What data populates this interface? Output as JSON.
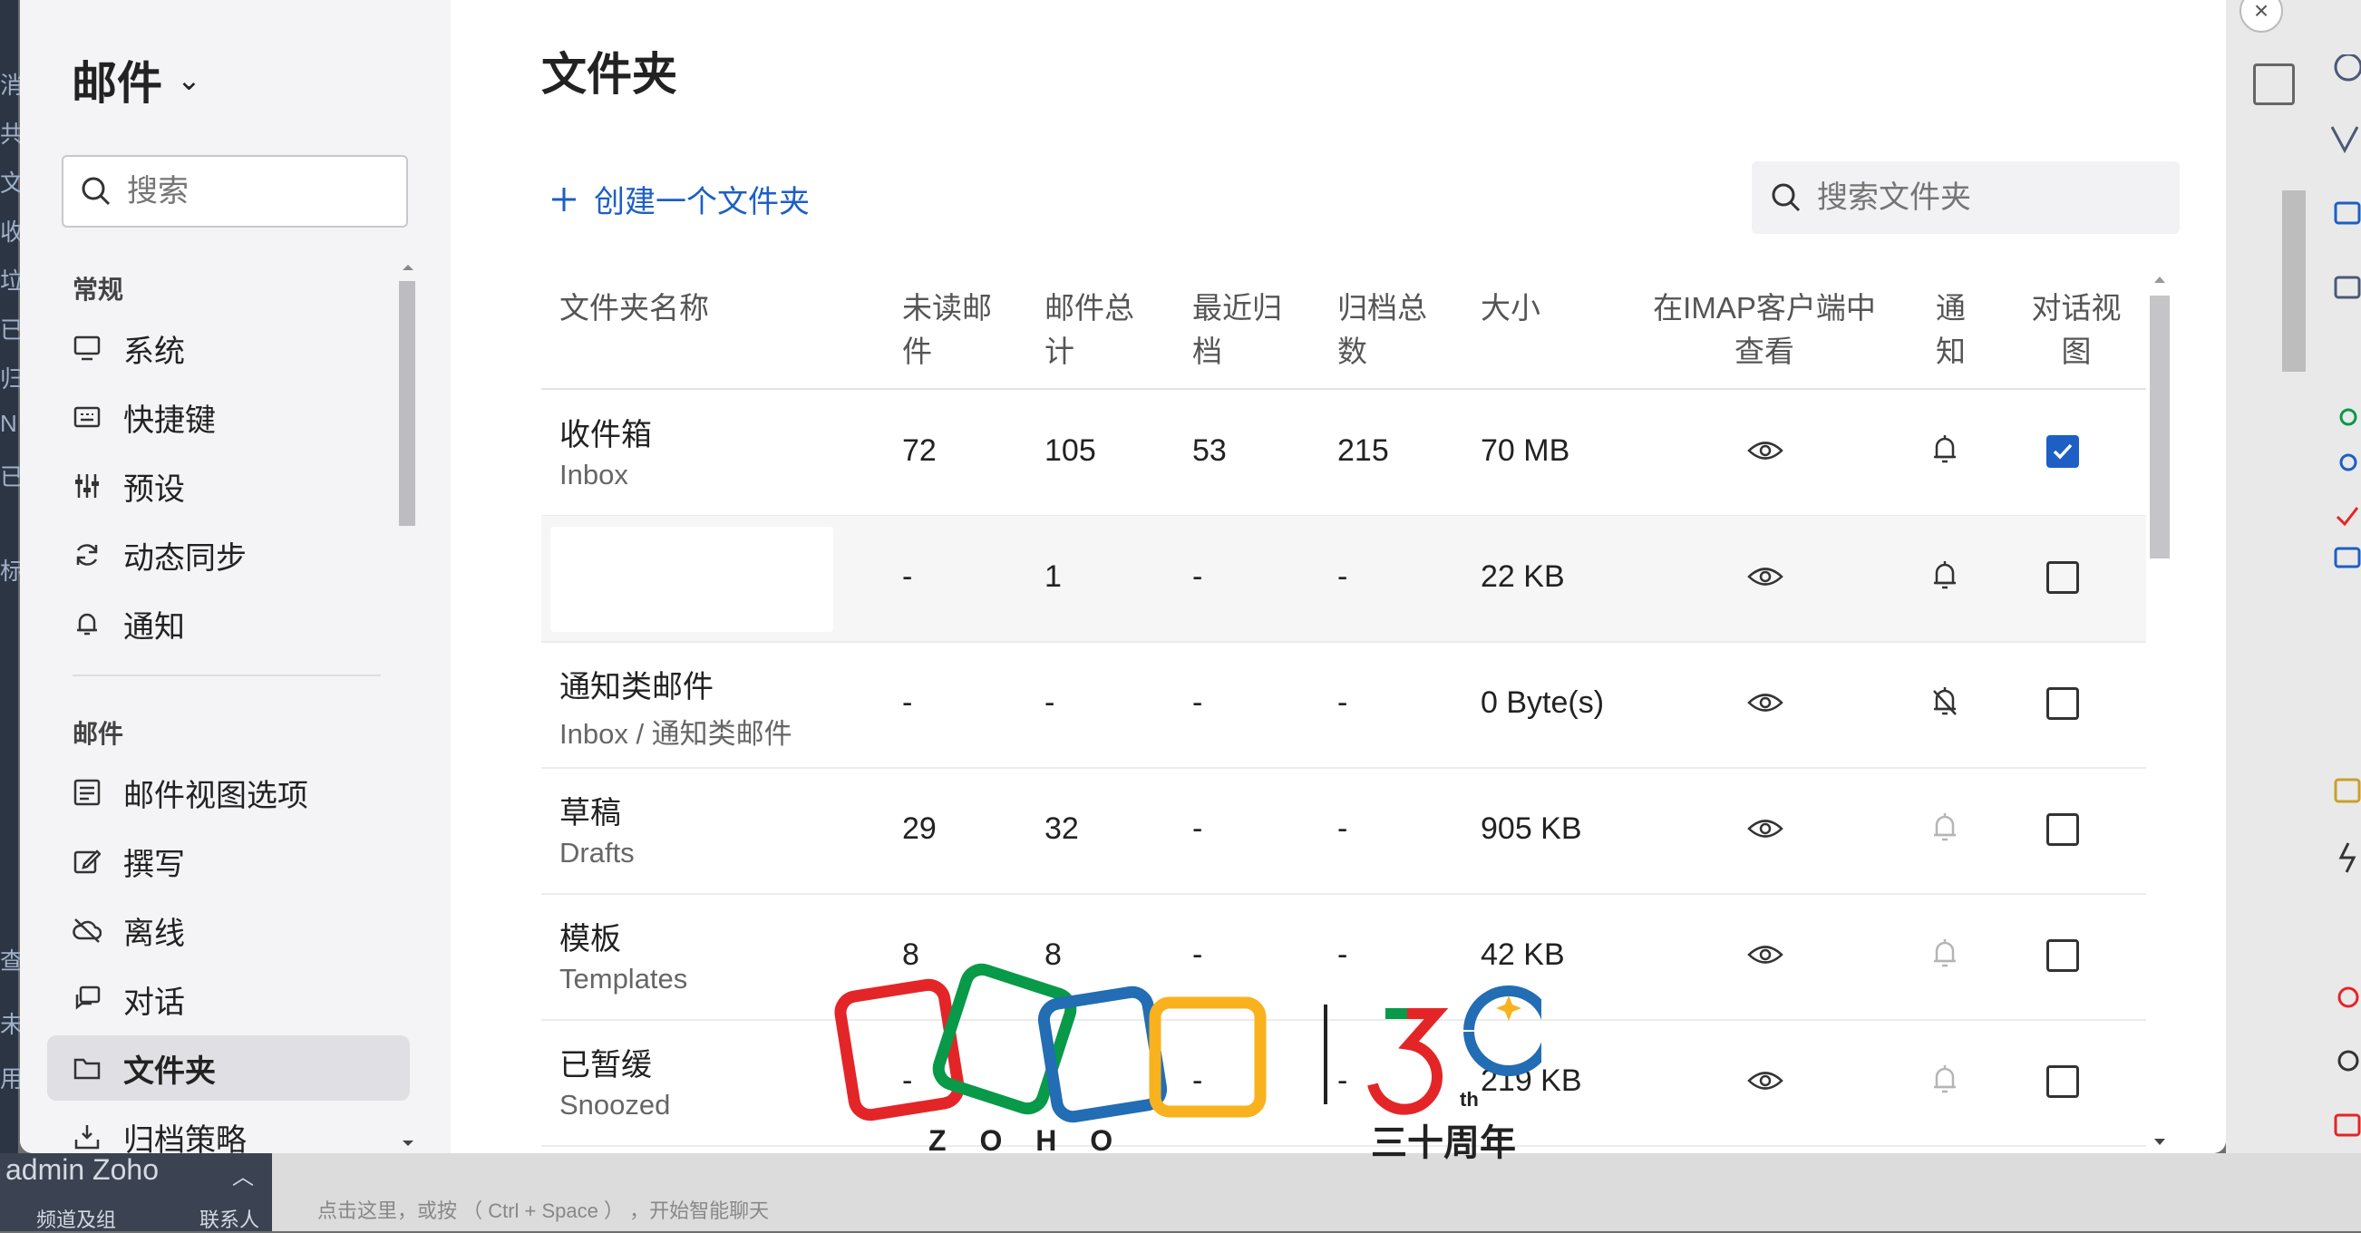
{
  "background": {
    "left_fragments": [
      "消",
      "共",
      "文",
      "收",
      "垃",
      "已",
      "归",
      "N",
      "已",
      "标",
      "查",
      "未",
      "用"
    ],
    "user": "admin Zoho",
    "bottom_tip": "点击这里，或按 （ Ctrl + Space ） ，开始智能聊天",
    "bottom_channels": "频道及组",
    "bottom_contacts": "联系人"
  },
  "sidebar": {
    "title": "邮件",
    "search_placeholder": "搜索",
    "sections": [
      {
        "label": "常规",
        "items": [
          {
            "label": "系统",
            "icon": "monitor-icon"
          },
          {
            "label": "快捷键",
            "icon": "keyboard-icon"
          },
          {
            "label": "预设",
            "icon": "sliders-icon"
          },
          {
            "label": "动态同步",
            "icon": "sync-icon"
          },
          {
            "label": "通知",
            "icon": "bell-icon"
          }
        ]
      },
      {
        "label": "邮件",
        "items": [
          {
            "label": "邮件视图选项",
            "icon": "layout-icon"
          },
          {
            "label": "撰写",
            "icon": "edit-icon"
          },
          {
            "label": "离线",
            "icon": "cloud-off-icon"
          },
          {
            "label": "对话",
            "icon": "chat-icon"
          },
          {
            "label": "文件夹",
            "icon": "folder-icon"
          },
          {
            "label": "归档策略",
            "icon": "archive-icon"
          }
        ]
      }
    ]
  },
  "main": {
    "title": "文件夹",
    "create_label": "创建一个文件夹",
    "search_placeholder": "搜索文件夹",
    "columns": {
      "name": "文件夹名称",
      "unread_1": "未读邮",
      "unread_2": "件",
      "total_1": "邮件总",
      "total_2": "计",
      "recent_1": "最近归",
      "recent_2": "档",
      "archived_1": "归档总",
      "archived_2": "数",
      "size": "大小",
      "imap_1": "在IMAP客户端中",
      "imap_2": "查看",
      "notify_1": "通",
      "notify_2": "知",
      "conv_1": "对话视",
      "conv_2": "图"
    },
    "rows": [
      {
        "name": "收件箱",
        "path": "Inbox",
        "unread": "72",
        "total": "105",
        "recent": "53",
        "archived": "215",
        "size": "70 MB",
        "notify": "on",
        "conversation": true
      },
      {
        "name": "",
        "path": "",
        "unread": "-",
        "total": "1",
        "recent": "-",
        "archived": "-",
        "size": "22 KB",
        "notify": "on",
        "conversation": false
      },
      {
        "name": "通知类邮件",
        "path": "Inbox / 通知类邮件",
        "unread": "-",
        "total": "-",
        "recent": "-",
        "archived": "-",
        "size": "0 Byte(s)",
        "notify": "off",
        "conversation": false
      },
      {
        "name": "草稿",
        "path": "Drafts",
        "unread": "29",
        "total": "32",
        "recent": "-",
        "archived": "-",
        "size": "905 KB",
        "notify": "disabled",
        "conversation": false
      },
      {
        "name": "模板",
        "path": "Templates",
        "unread": "8",
        "total": "8",
        "recent": "-",
        "archived": "-",
        "size": "42 KB",
        "notify": "disabled",
        "conversation": false
      },
      {
        "name": "已暂缓",
        "path": "Snoozed",
        "unread": "-",
        "total": "1",
        "recent": "-",
        "archived": "-",
        "size": "219 KB",
        "notify": "disabled",
        "conversation": false
      }
    ]
  },
  "watermark": {
    "brand": "Z O H O",
    "anniversary": "三十周年",
    "number_tail": "th",
    "colors": {
      "red": "#e42527",
      "green": "#089949",
      "blue": "#226db4",
      "yellow": "#f9b21d"
    }
  }
}
